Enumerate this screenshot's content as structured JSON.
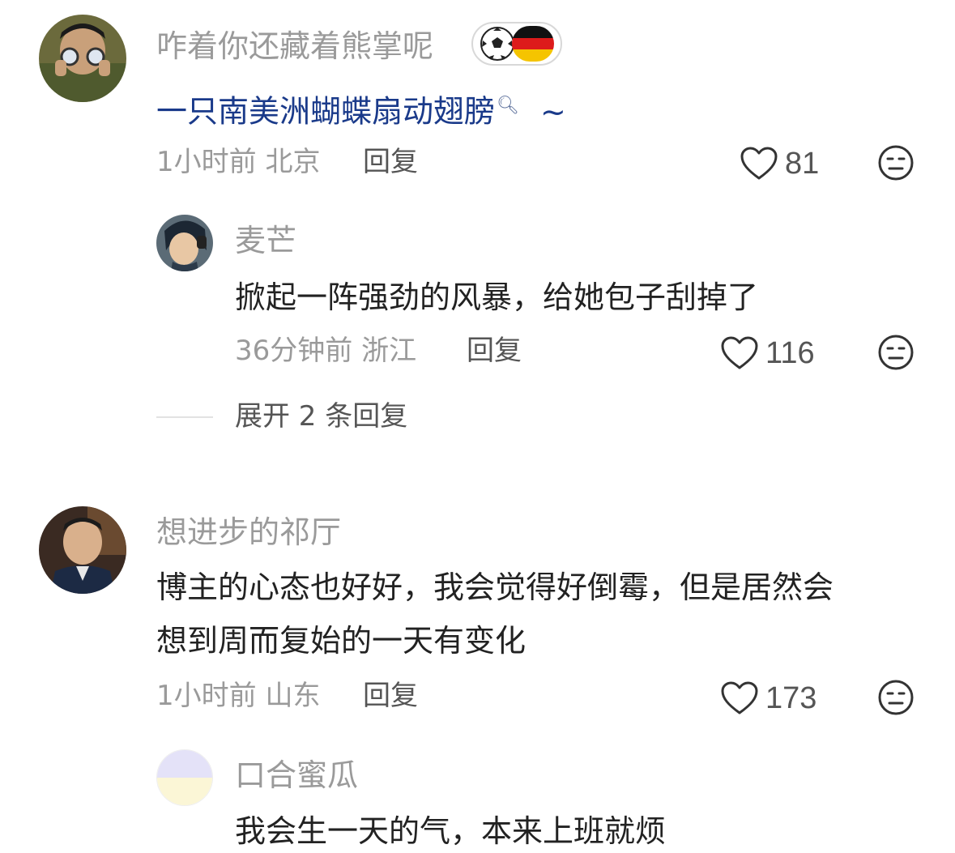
{
  "comments": [
    {
      "username": "咋着你还藏着熊掌呢",
      "content": "一只南美洲蝴蝶扇动翅膀",
      "content_suffix": "~",
      "time_location": "1小时前 北京",
      "reply_label": "回复",
      "likes": "81",
      "replies": [
        {
          "username": "麦芒",
          "content": "掀起一阵强劲的风暴，给她包子刮掉了",
          "time_location": "36分钟前 浙江",
          "reply_label": "回复",
          "likes": "116"
        }
      ],
      "expand_label": "展开 2 条回复"
    },
    {
      "username": "想进步的祁厅",
      "content_line1": "博主的心态也好好，我会觉得好倒霉，但是居然会",
      "content_line2": "想到周而复始的一天有变化",
      "time_location": "1小时前 山东",
      "reply_label": "回复",
      "likes": "173",
      "replies": [
        {
          "username": "口合蜜瓜",
          "content": "我会生一天的气，本来上班就烦"
        }
      ]
    }
  ],
  "colors": {
    "username": "#9a9a9a",
    "link_text": "#1a3a8a",
    "body_text": "#222222"
  },
  "icons": [
    "heart-icon",
    "emoji-face-icon",
    "soccer-ball-icon",
    "germany-flag-icon",
    "search-icon"
  ]
}
